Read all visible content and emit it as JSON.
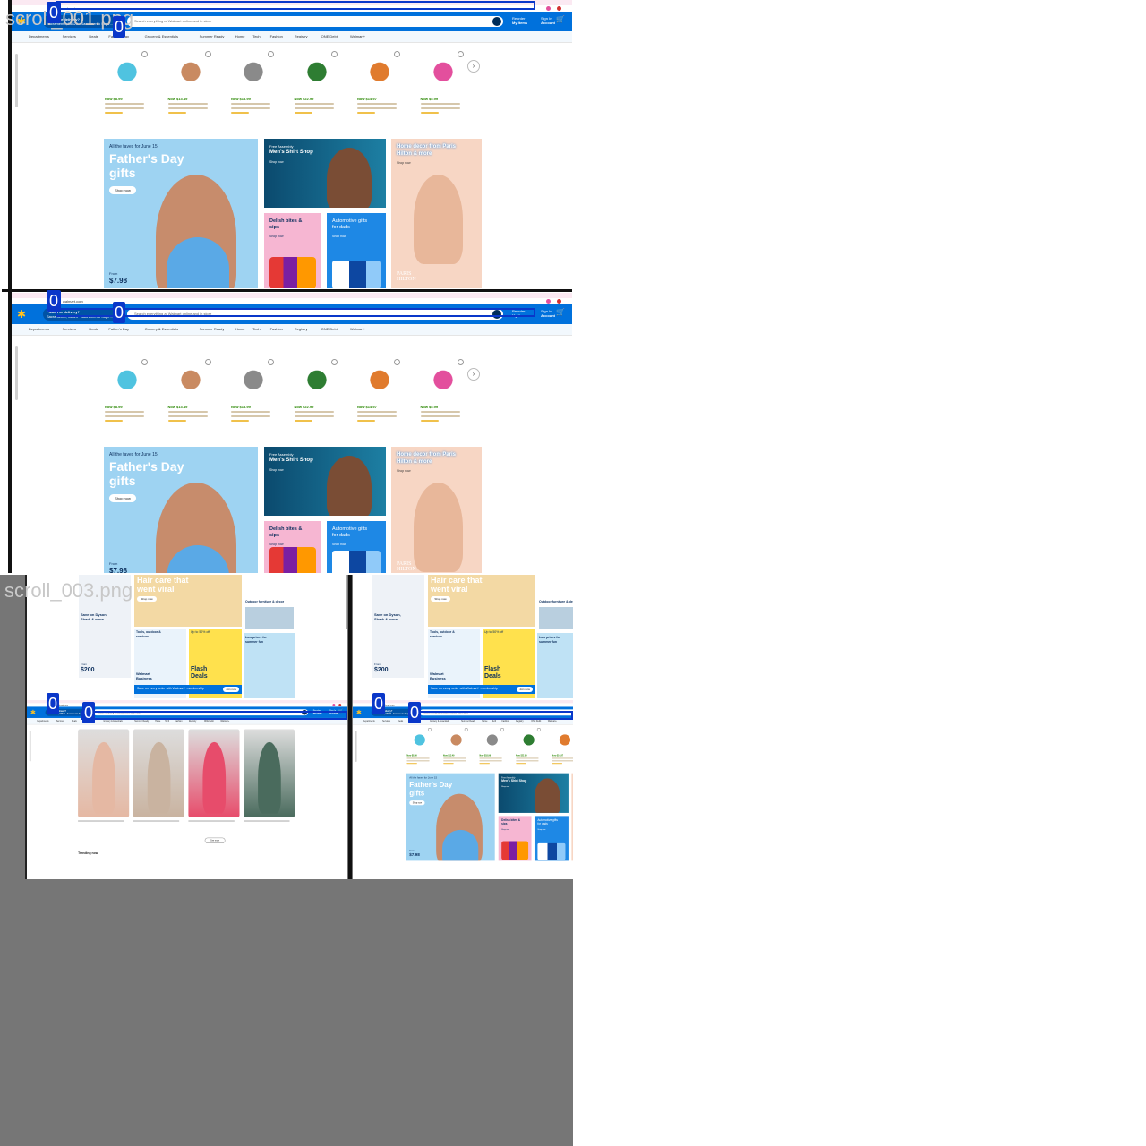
{
  "labels": {
    "frame1": "scroll_001.png",
    "frame3": "scroll_003.png"
  },
  "badges": {
    "index": "0"
  },
  "browser": {
    "url": "walmart.com"
  },
  "header": {
    "pickup_title": "Pickup or delivery?",
    "pickup_sub": "Sacramento, 95829 · Sacramento Supe…",
    "search_placeholder": "Search everything at Walmart online and in store",
    "reorder_top": "Reorder",
    "reorder_bottom": "My Items",
    "signin_top": "Sign In",
    "signin_bottom": "Account",
    "cart_count": "0"
  },
  "subnav": [
    "Departments",
    "Services",
    "Deals",
    "Father's Day",
    "Grocery & Essentials",
    "Summer Ready",
    "Home",
    "Tech",
    "Fashion",
    "Registry",
    "ONE Debit",
    "Walmart+"
  ],
  "products": [
    {
      "price": "Now $8.99",
      "color": "#4fc3e0"
    },
    {
      "price": "Now $13.49",
      "color": "#c98a61"
    },
    {
      "price": "Now $18.99",
      "color": "#8a8a8a"
    },
    {
      "price": "Now $22.99",
      "color": "#2e7d32"
    },
    {
      "price": "Now $14.97",
      "color": "#e07b2e"
    },
    {
      "price": "Now $5.99",
      "color": "#e34f9d"
    }
  ],
  "promos": {
    "fathers_kicker": "All the faves for June 15",
    "fathers_title_1": "Father's Day",
    "fathers_title_2": "gifts",
    "fathers_cta": "Shop now",
    "fathers_from": "From",
    "fathers_price": "$7.98",
    "mens_kicker": "Free Assembly",
    "mens_title": "Men's Shirt Shop",
    "mens_cta": "Shop now",
    "home_title_1": "Home decor from Paris",
    "home_title_2": "Hilton & more",
    "home_cta": "Shop now",
    "delish_1": "Delish bites &",
    "delish_2": "sips",
    "delish_cta": "Shop now",
    "auto_1": "Automotive gifts",
    "auto_2": "for dads",
    "auto_cta": "Shop now",
    "paris_logo": "PARIS HILTON"
  },
  "lower": {
    "haircare_1": "Hair care that",
    "haircare_2": "went viral",
    "haircare_cta": "Shop now",
    "savings_1": "Save on Dyson,",
    "savings_2": "Shark & more",
    "outdoor": "Outdoor furniture & decor",
    "tools_1": "Tools, outdoor &",
    "tools_2": "services",
    "up_to": "Up to 50% off",
    "flash_1": "Flash",
    "flash_2": "Deals",
    "summer_1": "Low prices for",
    "summer_2": "summer fun",
    "from": "From",
    "price": "$200",
    "walmart_business_1": "Walmart",
    "walmart_business_2": "Business",
    "banner": "Save on every order with Walmart+ membership",
    "join": "Join now",
    "trending": "Trending now",
    "more": "See more"
  },
  "colors": {
    "walmart_blue": "#0071dc",
    "walmart_yellow": "#ffc220",
    "badge_blue": "#0a37c9",
    "backdrop_gray": "#767676",
    "price_green": "#2a8703"
  }
}
